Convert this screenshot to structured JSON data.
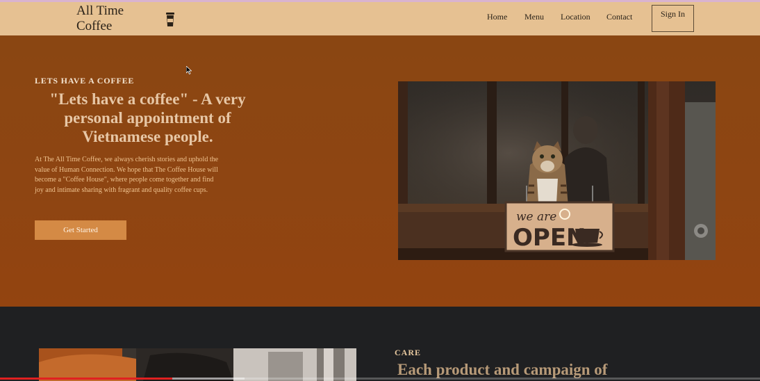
{
  "header": {
    "logo": "All Time Coffee",
    "logo_icon": "coffee-cup-icon",
    "nav": [
      "Home",
      "Menu",
      "Location",
      "Contact"
    ],
    "signin_label": "Sign In"
  },
  "hero": {
    "eyebrow": "LETS HAVE A COFFEE",
    "headline": "\"Lets have a coffee\" - A very personal appointment of Vietnamese people.",
    "description": "At The All Time Coffee, we always cherish stories and uphold the value of Human Connection. We hope that The Coffee House will become a \"Coffee House\", where people come together and find joy and intimate sharing with fragrant and quality coffee cups.",
    "cta_label": "Get Started",
    "photo_sign": {
      "line1": "we are",
      "line2": "OPEN"
    }
  },
  "care": {
    "label": "CARE",
    "title": "Each product and campaign of"
  },
  "video_progress": {
    "played_fraction": 0.227,
    "buffered_fraction": 0.322
  },
  "colors": {
    "header_bg": "#e6c192",
    "hero_bg": "#8e4512",
    "cta_bg": "#d48a45",
    "dark_section": "#1f2022",
    "progress_red": "#e02020"
  }
}
